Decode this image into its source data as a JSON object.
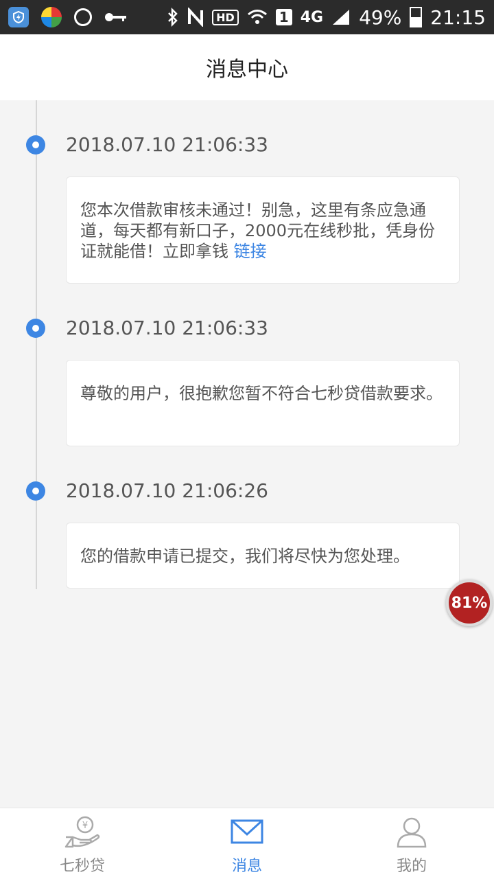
{
  "statusbar": {
    "signal_label": "4G",
    "sim_label": "1",
    "hd_label": "HD",
    "battery_percent": "49%",
    "battery_level": 0.49,
    "time": "21:15",
    "left_icons": [
      "shield-app-icon",
      "multicolor-app-icon",
      "settings-hex-icon",
      "key-icon"
    ],
    "right_icons": [
      "bluetooth-icon",
      "nfc-icon",
      "hd-icon",
      "wifi-icon",
      "sim-icon",
      "signal-icon",
      "battery-icon"
    ]
  },
  "header": {
    "title": "消息中心"
  },
  "messages": [
    {
      "timestamp": "2018.07.10 21:06:33",
      "text": "您本次借款审核未通过！别急，这里有条应急通道，每天都有新口子，2000元在线秒批，凭身份证就能借！立即拿钱 链接",
      "link_text": "链接"
    },
    {
      "timestamp": "2018.07.10 21:06:33",
      "text": "尊敬的用户，很抱歉您暂不符合七秒贷借款要求。",
      "link_text": ""
    },
    {
      "timestamp": "2018.07.10 21:06:26",
      "text": "您的借款申请已提交，我们将尽快为您处理。",
      "link_text": ""
    }
  ],
  "floating_badge": {
    "label": "81%"
  },
  "bottom_nav": {
    "items": [
      {
        "label": "七秒贷",
        "icon": "hand-coin-icon",
        "active": false
      },
      {
        "label": "消息",
        "icon": "envelope-icon",
        "active": true
      },
      {
        "label": "我的",
        "icon": "user-icon",
        "active": false
      }
    ]
  },
  "colors": {
    "accent": "#3d86e3",
    "inactive": "#888888",
    "background": "#f4f4f4"
  }
}
